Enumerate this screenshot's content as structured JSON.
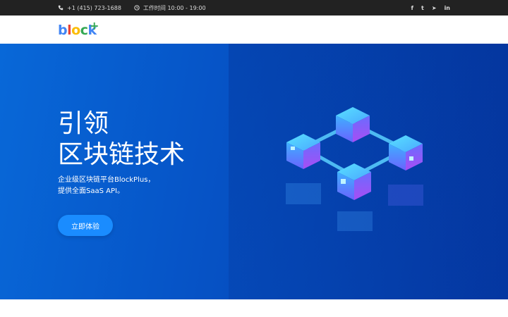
{
  "topbar": {
    "phone_icon": "phone-icon",
    "phone": "+1 (415) 723-1688",
    "clock_icon": "clock-icon",
    "hours": "工作时间 10:00 - 19:00",
    "social": [
      {
        "name": "facebook-icon",
        "glyph": "f"
      },
      {
        "name": "twitter-icon",
        "glyph": "t"
      },
      {
        "name": "telegram-icon",
        "glyph": "➤"
      },
      {
        "name": "linkedin-icon",
        "glyph": "in"
      }
    ]
  },
  "logo": {
    "letters": [
      {
        "char": "b",
        "color": "#4285f4"
      },
      {
        "char": "l",
        "color": "#ea4335"
      },
      {
        "char": "o",
        "color": "#fbbc05"
      },
      {
        "char": "c",
        "color": "#34a853"
      },
      {
        "char": "k",
        "color": "#4285f4"
      }
    ],
    "plus": "+"
  },
  "hero": {
    "title_line1": "引领",
    "title_line2": "区块链技术",
    "description": "企业级区块链平台BlockPlus，提供全面SaaS API。",
    "cta_label": "立即体验"
  },
  "colors": {
    "topbar_bg": "#222222",
    "hero_blue": "#0654c7",
    "cta_blue": "#1a8cff"
  }
}
